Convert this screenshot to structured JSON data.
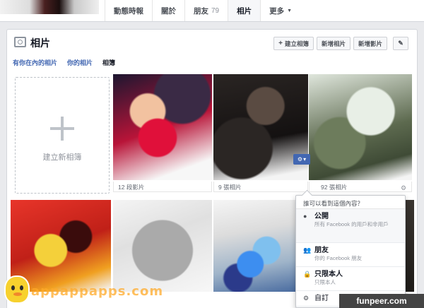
{
  "profile_tabs": [
    {
      "label": "動態時報",
      "count": ""
    },
    {
      "label": "關於",
      "count": ""
    },
    {
      "label": "朋友",
      "count": "79"
    },
    {
      "label": "相片",
      "count": ""
    },
    {
      "label": "更多",
      "count": ""
    }
  ],
  "photos": {
    "title": "相片",
    "buttons": {
      "create_album": "建立相簿",
      "add_photos": "新增相片",
      "add_videos": "新增影片"
    },
    "subtabs": [
      "有你在內的相片",
      "你的相片",
      "相簿"
    ],
    "create_album_tile": "建立新相簿",
    "albums": [
      {
        "meta": "12 段影片"
      },
      {
        "meta": "9 張相片"
      },
      {
        "meta": "92 張相片"
      }
    ]
  },
  "privacy_menu": {
    "header": "誰可以看到這個內容？",
    "options": [
      {
        "title": "公開",
        "desc": "所有 Facebook 的用戶和非用戶",
        "icon": "globe-icon"
      },
      {
        "title": "朋友",
        "desc": "你的 Facebook 朋友",
        "icon": "friends-icon"
      },
      {
        "title": "只限本人",
        "desc": "只限本人",
        "icon": "lock-icon"
      },
      {
        "title": "自訂",
        "desc": "",
        "icon": "gear-icon"
      }
    ]
  },
  "watermarks": {
    "left": "appappapps.com",
    "right": "funpeer.com"
  },
  "colors": {
    "fb_blue": "#4267b2",
    "page_bg": "#e9eaed"
  }
}
